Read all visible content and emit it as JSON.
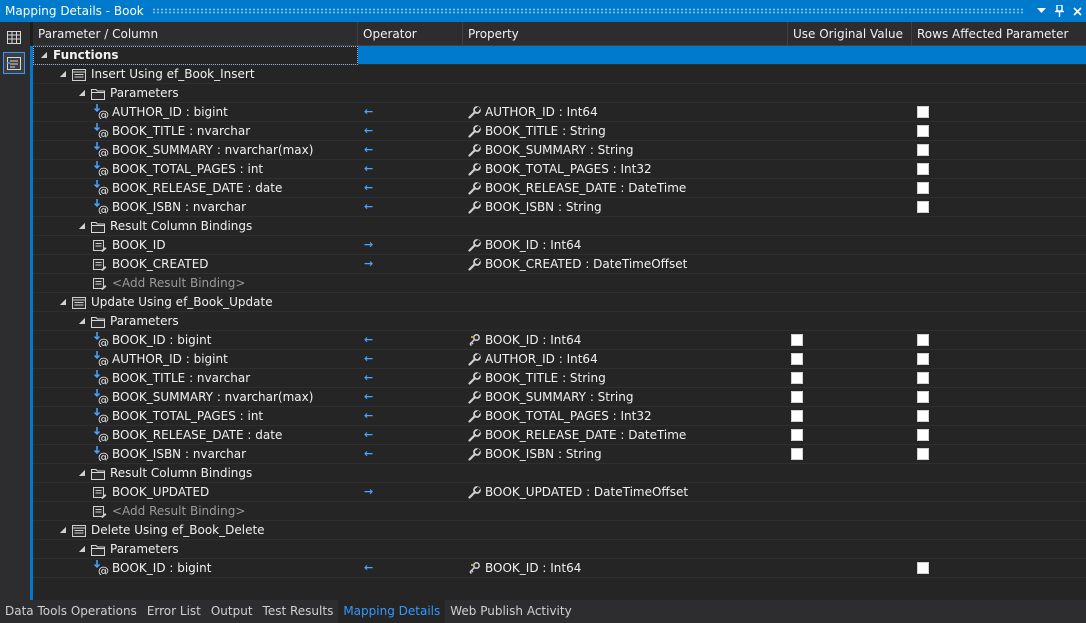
{
  "window": {
    "title": "Mapping Details - Book",
    "buttons": [
      "dropdown-icon",
      "pin-icon",
      "close-icon"
    ]
  },
  "toolstrip": [
    {
      "icon": "map-tables-icon",
      "active": false
    },
    {
      "icon": "map-functions-icon",
      "active": true
    }
  ],
  "columns": [
    "Parameter / Column",
    "Operator",
    "Property",
    "Use Original Value",
    "Rows Affected Parameter"
  ],
  "rows": [
    {
      "level": 0,
      "expander": "open",
      "icon": "none",
      "label": "Functions",
      "bold": true,
      "selected": true
    },
    {
      "level": 1,
      "expander": "open",
      "icon": "function",
      "label": "Insert Using ef_Book_Insert"
    },
    {
      "level": 2,
      "expander": "open",
      "icon": "folder",
      "label": "Parameters"
    },
    {
      "level": 3,
      "icon": "param",
      "label": "AUTHOR_ID : bigint",
      "op": "←",
      "prop_icon": "wrench",
      "prop": "AUTHOR_ID : Int64",
      "orig": null,
      "rows": false
    },
    {
      "level": 3,
      "icon": "param",
      "label": "BOOK_TITLE : nvarchar",
      "op": "←",
      "prop_icon": "wrench",
      "prop": "BOOK_TITLE : String",
      "orig": null,
      "rows": false
    },
    {
      "level": 3,
      "icon": "param",
      "label": "BOOK_SUMMARY : nvarchar(max)",
      "op": "←",
      "prop_icon": "wrench",
      "prop": "BOOK_SUMMARY : String",
      "orig": null,
      "rows": false
    },
    {
      "level": 3,
      "icon": "param",
      "label": "BOOK_TOTAL_PAGES : int",
      "op": "←",
      "prop_icon": "wrench",
      "prop": "BOOK_TOTAL_PAGES : Int32",
      "orig": null,
      "rows": false
    },
    {
      "level": 3,
      "icon": "param",
      "label": "BOOK_RELEASE_DATE : date",
      "op": "←",
      "prop_icon": "wrench",
      "prop": "BOOK_RELEASE_DATE : DateTime",
      "orig": null,
      "rows": false
    },
    {
      "level": 3,
      "icon": "param",
      "label": "BOOK_ISBN : nvarchar",
      "op": "←",
      "prop_icon": "wrench",
      "prop": "BOOK_ISBN : String",
      "orig": null,
      "rows": false
    },
    {
      "level": 2,
      "expander": "open",
      "icon": "folder",
      "label": "Result Column Bindings"
    },
    {
      "level": 3,
      "icon": "binding",
      "label": "BOOK_ID",
      "op": "→",
      "prop_icon": "wrench",
      "prop": "BOOK_ID : Int64",
      "orig": null,
      "rows": null
    },
    {
      "level": 3,
      "icon": "binding",
      "label": "BOOK_CREATED",
      "op": "→",
      "prop_icon": "wrench",
      "prop": "BOOK_CREATED : DateTimeOffset",
      "orig": null,
      "rows": null
    },
    {
      "level": 3,
      "icon": "binding",
      "label": "<Add Result Binding>",
      "placeholder": true
    },
    {
      "level": 1,
      "expander": "open",
      "icon": "function",
      "label": "Update Using ef_Book_Update"
    },
    {
      "level": 2,
      "expander": "open",
      "icon": "folder",
      "label": "Parameters"
    },
    {
      "level": 3,
      "icon": "param",
      "label": "BOOK_ID : bigint",
      "op": "←",
      "prop_icon": "key",
      "prop": "BOOK_ID : Int64",
      "orig": false,
      "rows": false
    },
    {
      "level": 3,
      "icon": "param",
      "label": "AUTHOR_ID : bigint",
      "op": "←",
      "prop_icon": "wrench",
      "prop": "AUTHOR_ID : Int64",
      "orig": false,
      "rows": false
    },
    {
      "level": 3,
      "icon": "param",
      "label": "BOOK_TITLE : nvarchar",
      "op": "←",
      "prop_icon": "wrench",
      "prop": "BOOK_TITLE : String",
      "orig": false,
      "rows": false
    },
    {
      "level": 3,
      "icon": "param",
      "label": "BOOK_SUMMARY : nvarchar(max)",
      "op": "←",
      "prop_icon": "wrench",
      "prop": "BOOK_SUMMARY : String",
      "orig": false,
      "rows": false
    },
    {
      "level": 3,
      "icon": "param",
      "label": "BOOK_TOTAL_PAGES : int",
      "op": "←",
      "prop_icon": "wrench",
      "prop": "BOOK_TOTAL_PAGES : Int32",
      "orig": false,
      "rows": false
    },
    {
      "level": 3,
      "icon": "param",
      "label": "BOOK_RELEASE_DATE : date",
      "op": "←",
      "prop_icon": "wrench",
      "prop": "BOOK_RELEASE_DATE : DateTime",
      "orig": false,
      "rows": false
    },
    {
      "level": 3,
      "icon": "param",
      "label": "BOOK_ISBN : nvarchar",
      "op": "←",
      "prop_icon": "wrench",
      "prop": "BOOK_ISBN : String",
      "orig": false,
      "rows": false
    },
    {
      "level": 2,
      "expander": "open",
      "icon": "folder",
      "label": "Result Column Bindings"
    },
    {
      "level": 3,
      "icon": "binding",
      "label": "BOOK_UPDATED",
      "op": "→",
      "prop_icon": "wrench",
      "prop": "BOOK_UPDATED : DateTimeOffset",
      "orig": null,
      "rows": null
    },
    {
      "level": 3,
      "icon": "binding",
      "label": "<Add Result Binding>",
      "placeholder": true
    },
    {
      "level": 1,
      "expander": "open",
      "icon": "function",
      "label": "Delete Using ef_Book_Delete"
    },
    {
      "level": 2,
      "expander": "open",
      "icon": "folder",
      "label": "Parameters"
    },
    {
      "level": 3,
      "icon": "param",
      "label": "BOOK_ID : bigint",
      "op": "←",
      "prop_icon": "key",
      "prop": "BOOK_ID : Int64",
      "orig": null,
      "rows": false
    }
  ],
  "bottom_tabs": [
    {
      "label": "Data Tools Operations",
      "active": false
    },
    {
      "label": "Error List",
      "active": false
    },
    {
      "label": "Output",
      "active": false
    },
    {
      "label": "Test Results",
      "active": false
    },
    {
      "label": "Mapping Details",
      "active": true
    },
    {
      "label": "Web Publish Activity",
      "active": false
    }
  ],
  "colors": {
    "accent": "#007acc",
    "background": "#252526",
    "operator_arrow": "#4aa3ff",
    "active_tab_text": "#3399ff"
  }
}
